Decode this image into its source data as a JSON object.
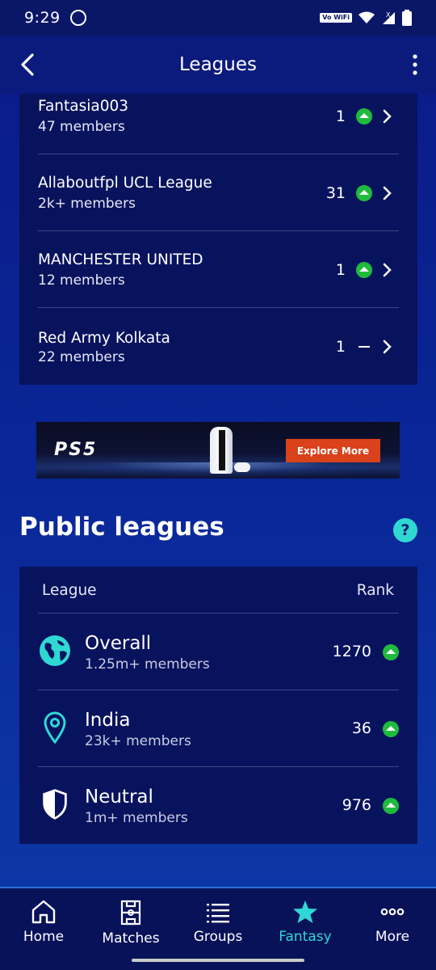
{
  "status_bar": {
    "time": "9:29",
    "vowifi": "Vo WiFi",
    "signal_label": "X"
  },
  "header": {
    "title": "Leagues"
  },
  "private_leagues": [
    {
      "name": "Fantasia003",
      "members": "47 members",
      "rank": "1",
      "movement": "up"
    },
    {
      "name": "Allaboutfpl UCL League",
      "members": "2k+ members",
      "rank": "31",
      "movement": "up"
    },
    {
      "name": "MANCHESTER UNITED",
      "members": "12 members",
      "rank": "1",
      "movement": "up"
    },
    {
      "name": "Red Army Kolkata",
      "members": "22 members",
      "rank": "1",
      "movement": "same"
    }
  ],
  "ad": {
    "logo": "PS5",
    "button": "Explore More"
  },
  "public_leagues": {
    "title": "Public leagues",
    "help": "?",
    "col_league": "League",
    "col_rank": "Rank",
    "items": [
      {
        "name": "Overall",
        "members": "1.25m+ members",
        "rank": "1270",
        "icon": "globe-icon",
        "movement": "up"
      },
      {
        "name": "India",
        "members": "23k+ members",
        "rank": "36",
        "icon": "location-pin-icon",
        "movement": "up"
      },
      {
        "name": "Neutral",
        "members": "1m+ members",
        "rank": "976",
        "icon": "shield-icon",
        "movement": "up"
      }
    ]
  },
  "nav": {
    "home": "Home",
    "matches": "Matches",
    "groups": "Groups",
    "fantasy": "Fantasy",
    "more": "More",
    "active": "fantasy"
  },
  "colors": {
    "up": "#1fbb3c",
    "accent": "#2fd8d3",
    "ad_button": "#d9421b"
  }
}
